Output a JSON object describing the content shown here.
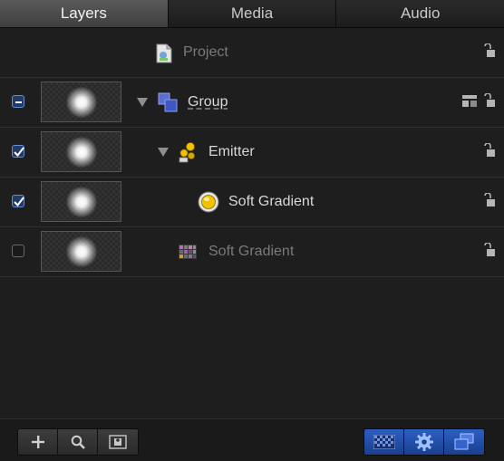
{
  "tabs": [
    {
      "label": "Layers",
      "active": true
    },
    {
      "label": "Media",
      "active": false
    },
    {
      "label": "Audio",
      "active": false
    }
  ],
  "project": {
    "label": "Project",
    "icon": "project-file-icon"
  },
  "layers": [
    {
      "label": "Group",
      "checkbox": "mixed",
      "icon": "group-layers-icon",
      "expanded": true
    },
    {
      "label": "Emitter",
      "checkbox": "checked",
      "icon": "emitter-icon",
      "expanded": true
    },
    {
      "label": "Soft Gradient",
      "checkbox": "checked",
      "icon": "particle-cell-icon"
    },
    {
      "label": "Soft Gradient",
      "checkbox": "unchecked",
      "icon": "image-source-icon"
    }
  ],
  "toolbar": {
    "left": [
      "plus-icon",
      "search-icon",
      "thumbnail-icon"
    ],
    "right": [
      "checkerboard-icon",
      "gear-icon",
      "layers-icon"
    ]
  },
  "colors": {
    "accent": "#2c5fc4",
    "checkbox_fill": "#213a66",
    "emitter_yellow": "#f2c200"
  }
}
